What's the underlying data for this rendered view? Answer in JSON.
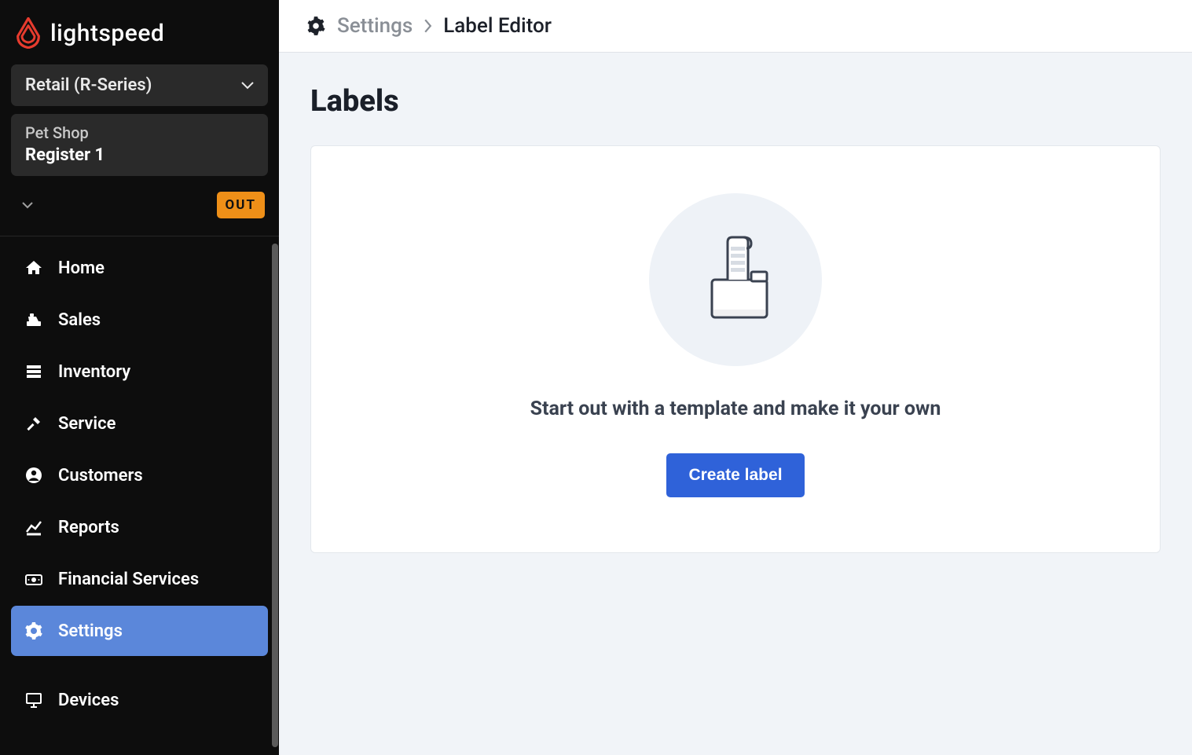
{
  "brand": {
    "name": "lightspeed"
  },
  "product_selector": {
    "label": "Retail (R-Series)"
  },
  "register_box": {
    "shop": "Pet Shop",
    "register": "Register 1"
  },
  "badge": {
    "out": "OUT"
  },
  "nav": {
    "home": "Home",
    "sales": "Sales",
    "inventory": "Inventory",
    "service": "Service",
    "customers": "Customers",
    "reports": "Reports",
    "financial": "Financial Services",
    "settings": "Settings",
    "devices": "Devices"
  },
  "breadcrumb": {
    "parent": "Settings",
    "current": "Label Editor"
  },
  "page": {
    "title": "Labels",
    "empty_message": "Start out with a template and make it your own",
    "create_button": "Create label"
  }
}
